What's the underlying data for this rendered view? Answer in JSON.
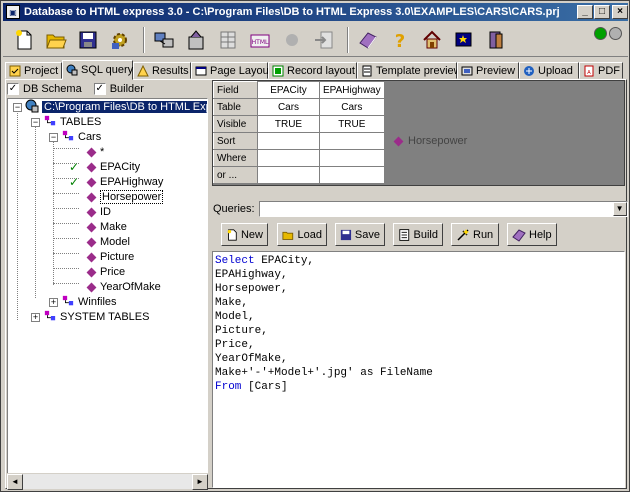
{
  "window": {
    "title": "Database to HTML express 3.0 - C:\\Program Files\\DB to HTML Express 3.0\\EXAMPLES\\CARS\\CARS.prj",
    "controls": {
      "minimize": "_",
      "maximize": "□",
      "close": "×"
    }
  },
  "toolbar": {
    "icons": [
      "new-doc-icon",
      "open-folder-icon",
      "save-icon",
      "settings-icon",
      "database-icon",
      "wizard-icon",
      "table-icon",
      "html-icon",
      "circle-icon",
      "export-icon",
      "book-icon",
      "help-icon",
      "home-icon",
      "wand-icon",
      "exit-icon"
    ],
    "lights": [
      "#00a000",
      "#b0b0b0"
    ]
  },
  "tabs": [
    {
      "label": "Project",
      "icon": "project-icon"
    },
    {
      "label": "SQL query",
      "icon": "sql-icon",
      "active": true
    },
    {
      "label": "Results",
      "icon": "results-icon"
    },
    {
      "label": "Page Layout",
      "icon": "page-icon"
    },
    {
      "label": "Record layout",
      "icon": "record-icon"
    },
    {
      "label": "Template preview",
      "icon": "template-icon"
    },
    {
      "label": "Preview",
      "icon": "preview-icon"
    },
    {
      "label": "Upload",
      "icon": "upload-icon"
    },
    {
      "label": "PDF",
      "icon": "pdf-icon"
    }
  ],
  "options": {
    "db_schema": {
      "label": "DB Schema",
      "checked": "✓"
    },
    "builder": {
      "label": "Builder",
      "checked": "✓"
    }
  },
  "tree": {
    "root": "C:\\Program Files\\DB to HTML Express",
    "tables": "TABLES",
    "cars": "Cars",
    "fields": [
      "*",
      "EPACity",
      "EPAHighway",
      "Horsepower",
      "ID",
      "Make",
      "Model",
      "Picture",
      "Price",
      "YearOfMake"
    ],
    "checked": [
      "EPACity",
      "EPAHighway"
    ],
    "winfiles": "Winfiles",
    "system_tables": "SYSTEM TABLES",
    "expand_minus": "−",
    "expand_plus": "+"
  },
  "grid": {
    "row_labels": [
      "Field",
      "Table",
      "Visible",
      "Sort",
      "Where",
      "or ..."
    ],
    "columns": [
      {
        "field": "EPACity",
        "table": "Cars",
        "visible": "TRUE"
      },
      {
        "field": "EPAHighway",
        "table": "Cars",
        "visible": "TRUE"
      }
    ],
    "floating_field": "Horsepower"
  },
  "queries": {
    "label": "Queries:",
    "value": ""
  },
  "buttons": {
    "new": "New",
    "load": "Load",
    "save": "Save",
    "build": "Build",
    "run": "Run",
    "help": "Help"
  },
  "sql": {
    "lines": [
      [
        {
          "t": "Select",
          "kw": true
        },
        {
          "t": " EPACity,"
        }
      ],
      [
        {
          "t": "EPAHighway,"
        }
      ],
      [
        {
          "t": "Horsepower,"
        }
      ],
      [
        {
          "t": "Make,"
        }
      ],
      [
        {
          "t": "Model,"
        }
      ],
      [
        {
          "t": "Picture,"
        }
      ],
      [
        {
          "t": "Price,"
        }
      ],
      [
        {
          "t": "YearOfMake,"
        }
      ],
      [
        {
          "t": "Make+'-'+Model+'.jpg' as FileName"
        }
      ],
      [
        {
          "t": "From",
          "kw": true
        },
        {
          "t": " [Cars]"
        }
      ]
    ]
  },
  "scroll": {
    "left": "◄",
    "right": "►"
  }
}
